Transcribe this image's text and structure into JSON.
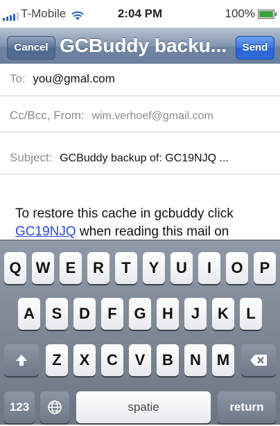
{
  "status_bar": {
    "carrier": "T-Mobile",
    "time": "2:04 PM",
    "battery": "100%",
    "signal_icon": "signal-bars-icon",
    "wifi_icon": "wifi-icon",
    "battery_icon": "battery-icon"
  },
  "nav": {
    "cancel_label": "Cancel",
    "title": "GCBuddy backu...",
    "send_label": "Send"
  },
  "fields": {
    "to_label": "To:",
    "to_value": "you@gmal.com",
    "ccbcc_label": "Cc/Bcc, From:",
    "from_value": "wim.verhoef@gmail.com",
    "subject_label": "Subject:",
    "subject_value": "GCBuddy backup of: GC19NJQ ..."
  },
  "body": {
    "line1": "To restore this cache in gcbuddy click",
    "link_text": "GC19NJQ",
    "line2_rest": " when reading this mail on"
  },
  "keyboard": {
    "row1": [
      "Q",
      "W",
      "E",
      "R",
      "T",
      "Y",
      "U",
      "I",
      "O",
      "P"
    ],
    "row2": [
      "A",
      "S",
      "D",
      "F",
      "G",
      "H",
      "J",
      "K",
      "L"
    ],
    "row3": [
      "Z",
      "X",
      "C",
      "V",
      "B",
      "N",
      "M"
    ],
    "numbers_label": "123",
    "space_label": "spatie",
    "return_label": "return",
    "shift_icon": "shift-arrow-icon",
    "backspace_icon": "backspace-icon",
    "globe_icon": "globe-icon"
  },
  "colors": {
    "nav_bar": "#7b90ab",
    "send_button": "#2f6bdc",
    "link": "#2948d6"
  }
}
